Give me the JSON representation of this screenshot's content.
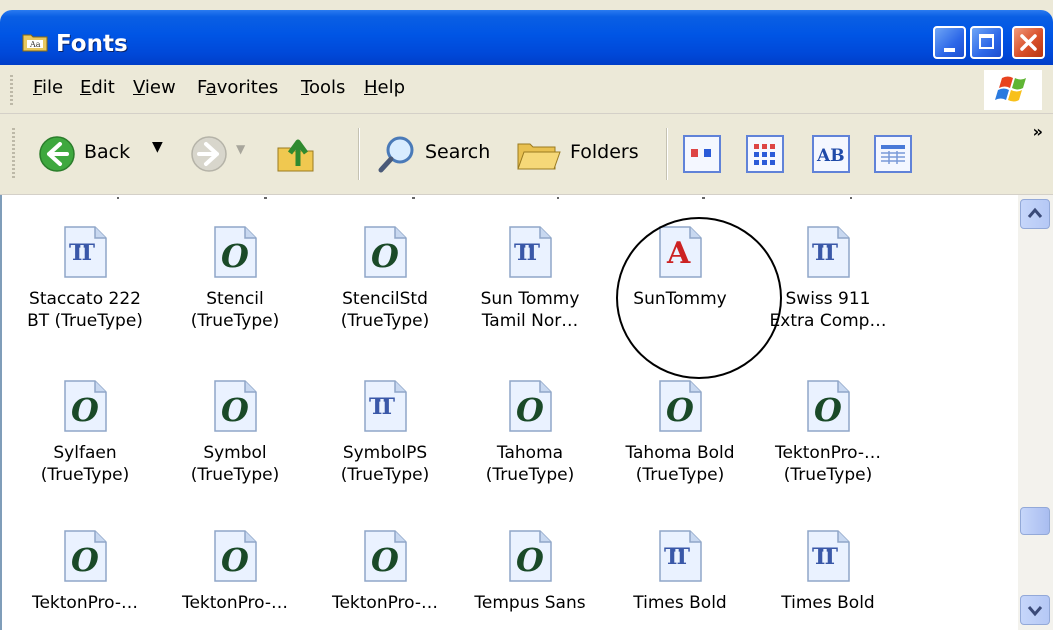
{
  "window": {
    "title": "Fonts"
  },
  "menu": [
    {
      "label": "File",
      "accel": "F"
    },
    {
      "label": "Edit",
      "accel": "E"
    },
    {
      "label": "View",
      "accel": "V"
    },
    {
      "label": "Favorites",
      "accel": "a"
    },
    {
      "label": "Tools",
      "accel": "T"
    },
    {
      "label": "Help",
      "accel": "H"
    }
  ],
  "toolbar": {
    "back_label": "Back",
    "search_label": "Search",
    "folders_label": "Folders",
    "overflow": "»"
  },
  "fonts": [
    {
      "name": "Staccato 222\nBT (TrueType)",
      "icon": "truetype-icon"
    },
    {
      "name": "Stencil\n(TrueType)",
      "icon": "opentype-icon"
    },
    {
      "name": "StencilStd\n(TrueType)",
      "icon": "opentype-icon"
    },
    {
      "name": "Sun Tommy\nTamil Nor…",
      "icon": "truetype-icon"
    },
    {
      "name": "SunTommy",
      "icon": "raster-font-icon"
    },
    {
      "name": "Swiss 911\nExtra Comp…",
      "icon": "truetype-icon"
    },
    {
      "name": "Sylfaen\n(TrueType)",
      "icon": "opentype-icon"
    },
    {
      "name": "Symbol\n(TrueType)",
      "icon": "opentype-icon"
    },
    {
      "name": "SymbolPS\n(TrueType)",
      "icon": "truetype-icon"
    },
    {
      "name": "Tahoma\n(TrueType)",
      "icon": "opentype-icon"
    },
    {
      "name": "Tahoma Bold\n(TrueType)",
      "icon": "opentype-icon"
    },
    {
      "name": "TektonPro-…\n(TrueType)",
      "icon": "opentype-icon"
    },
    {
      "name": "TektonPro-…",
      "icon": "opentype-icon"
    },
    {
      "name": "TektonPro-…",
      "icon": "opentype-icon"
    },
    {
      "name": "TektonPro-…",
      "icon": "opentype-icon"
    },
    {
      "name": "Tempus Sans",
      "icon": "opentype-icon"
    },
    {
      "name": "Times Bold",
      "icon": "truetype-icon"
    },
    {
      "name": "Times Bold",
      "icon": "truetype-icon"
    }
  ],
  "colors": {
    "titlebar": "#0055e5",
    "close": "#d9502a",
    "selection_circle": "#000000"
  }
}
